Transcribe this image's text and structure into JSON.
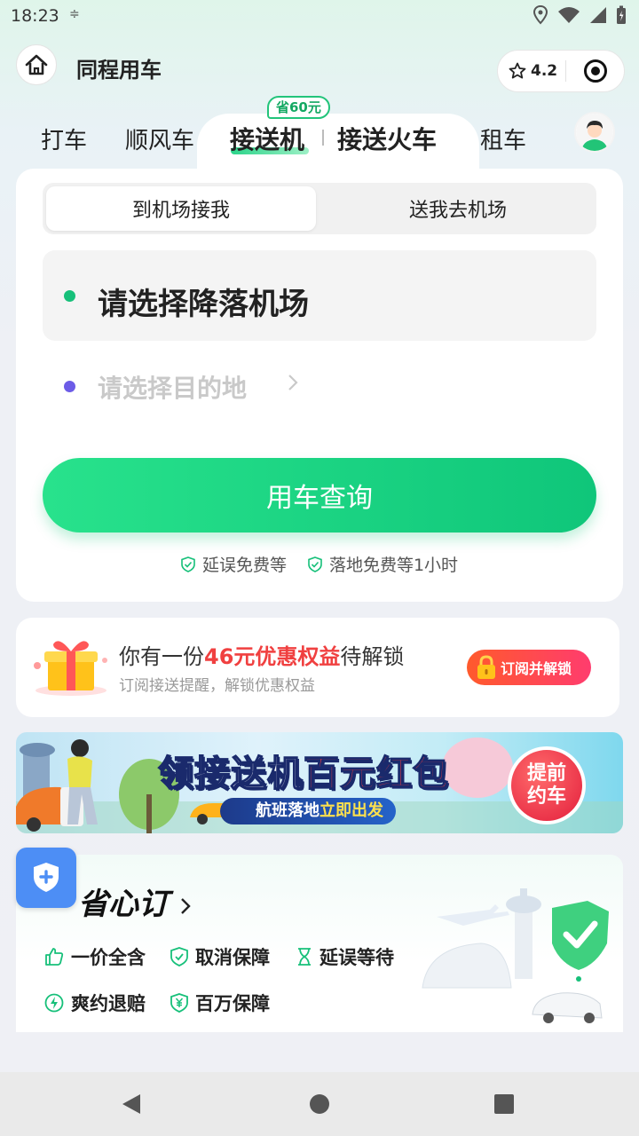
{
  "status": {
    "time": "18:23"
  },
  "header": {
    "title": "同程用车",
    "rating": "4.2"
  },
  "tabs": {
    "items": [
      "打车",
      "顺风车",
      "接送机",
      "接送火车",
      "租车"
    ],
    "active_index": 2,
    "badge": "省60元"
  },
  "pickup": {
    "segment": {
      "option1": "到机场接我",
      "option2": "送我去机场",
      "selected": "到机场接我"
    },
    "airport_prompt": "请选择降落机场",
    "destination_placeholder": "请选择目的地",
    "cta": "用车查询",
    "perks": [
      "延误免费等",
      "落地免费等1小时"
    ]
  },
  "promo": {
    "title_prefix": "你有一份",
    "title_highlight": "46元优惠权益",
    "title_suffix": "待解锁",
    "subtitle": "订阅接送提醒，解锁优惠权益",
    "button": "订阅并解锁"
  },
  "banner": {
    "title_part1": "领接送机",
    "title_part2": "百元红包",
    "strip_part1": "航班落地",
    "strip_part2": "立即出发",
    "button": "提前约车"
  },
  "shengxin": {
    "title": "省心订",
    "features": [
      "一价全含",
      "取消保障",
      "延误等待",
      "爽约退赔",
      "百万保障"
    ]
  },
  "colors": {
    "brand_green": "#17c07a",
    "promo_red": "#f04040",
    "accent_purple": "#6c5ce7"
  }
}
